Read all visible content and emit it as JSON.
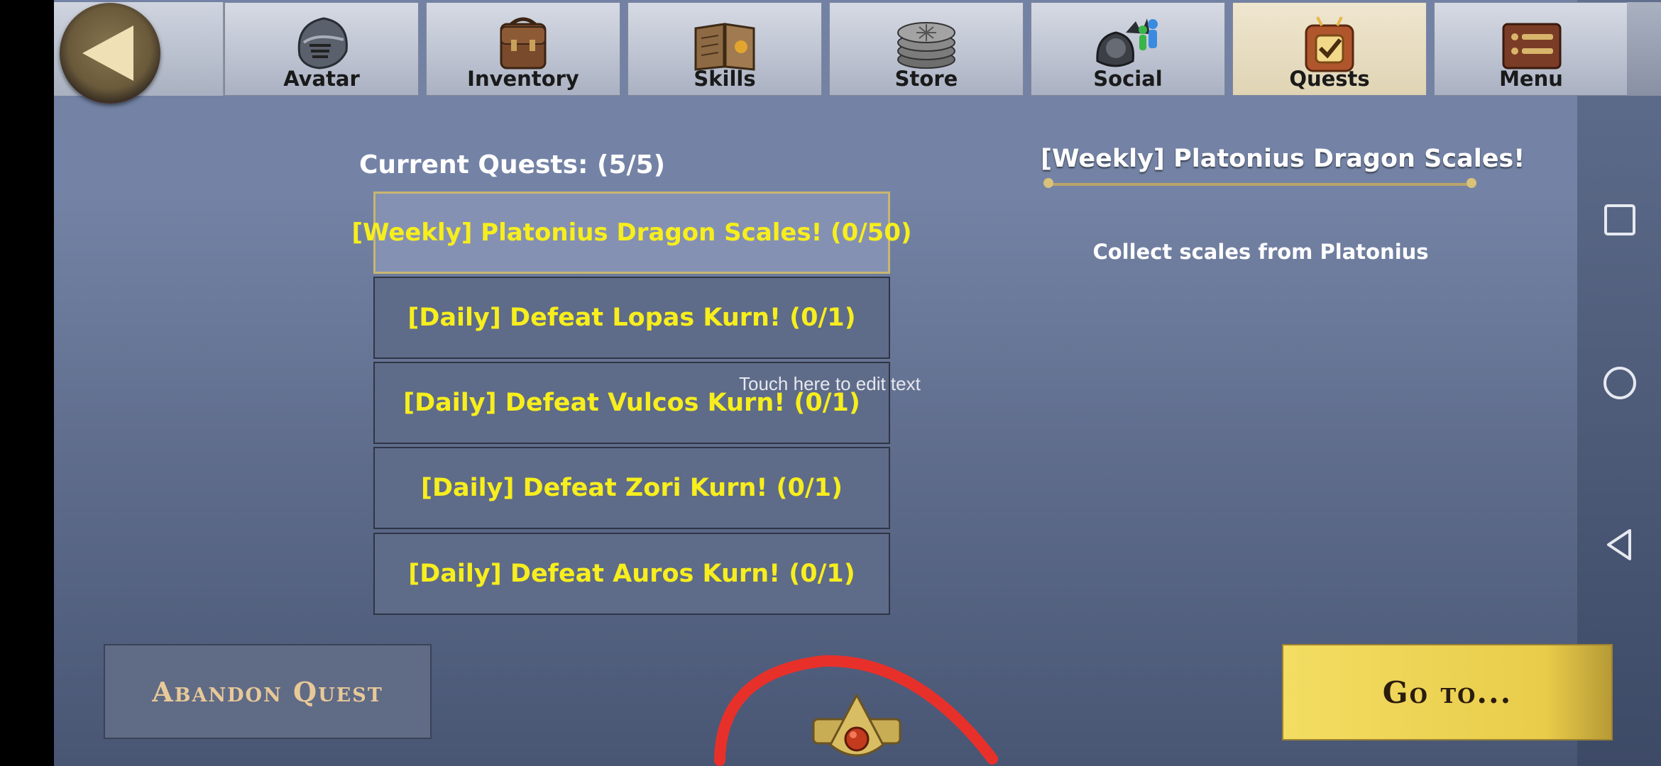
{
  "tabs": [
    {
      "label": "Avatar",
      "icon": "helmet-icon"
    },
    {
      "label": "Inventory",
      "icon": "backpack-icon"
    },
    {
      "label": "Skills",
      "icon": "spellbook-icon"
    },
    {
      "label": "Store",
      "icon": "coins-icon"
    },
    {
      "label": "Social",
      "icon": "social-people-icon"
    },
    {
      "label": "Quests",
      "icon": "quest-board-icon",
      "active": true
    },
    {
      "label": "Menu",
      "icon": "menu-list-icon"
    }
  ],
  "quests": {
    "title": "Current Quests: (5/5)",
    "items": [
      {
        "text": "[Weekly] Platonius Dragon Scales! (0/50)",
        "selected": true
      },
      {
        "text": "[Daily] Defeat Lopas Kurn! (0/1)"
      },
      {
        "text": "[Daily] Defeat Vulcos Kurn! (0/1)"
      },
      {
        "text": "[Daily] Defeat Zori Kurn! (0/1)"
      },
      {
        "text": "[Daily] Defeat Auros Kurn! (0/1)"
      }
    ]
  },
  "edit_hint": "Touch here to edit text",
  "detail": {
    "title": "[Weekly] Platonius Dragon Scales!",
    "description": "Collect scales from Platonius"
  },
  "buttons": {
    "abandon": "Abandon Quest",
    "goto": "Go to..."
  },
  "colors": {
    "quest_text": "#f7ee1d",
    "selected_border": "#c8b671",
    "annotation": "#e8302a",
    "goto_bg": "#f3dd62"
  },
  "system_nav": {
    "recents": "square-icon",
    "home": "circle-icon",
    "back": "triangle-back-icon"
  }
}
